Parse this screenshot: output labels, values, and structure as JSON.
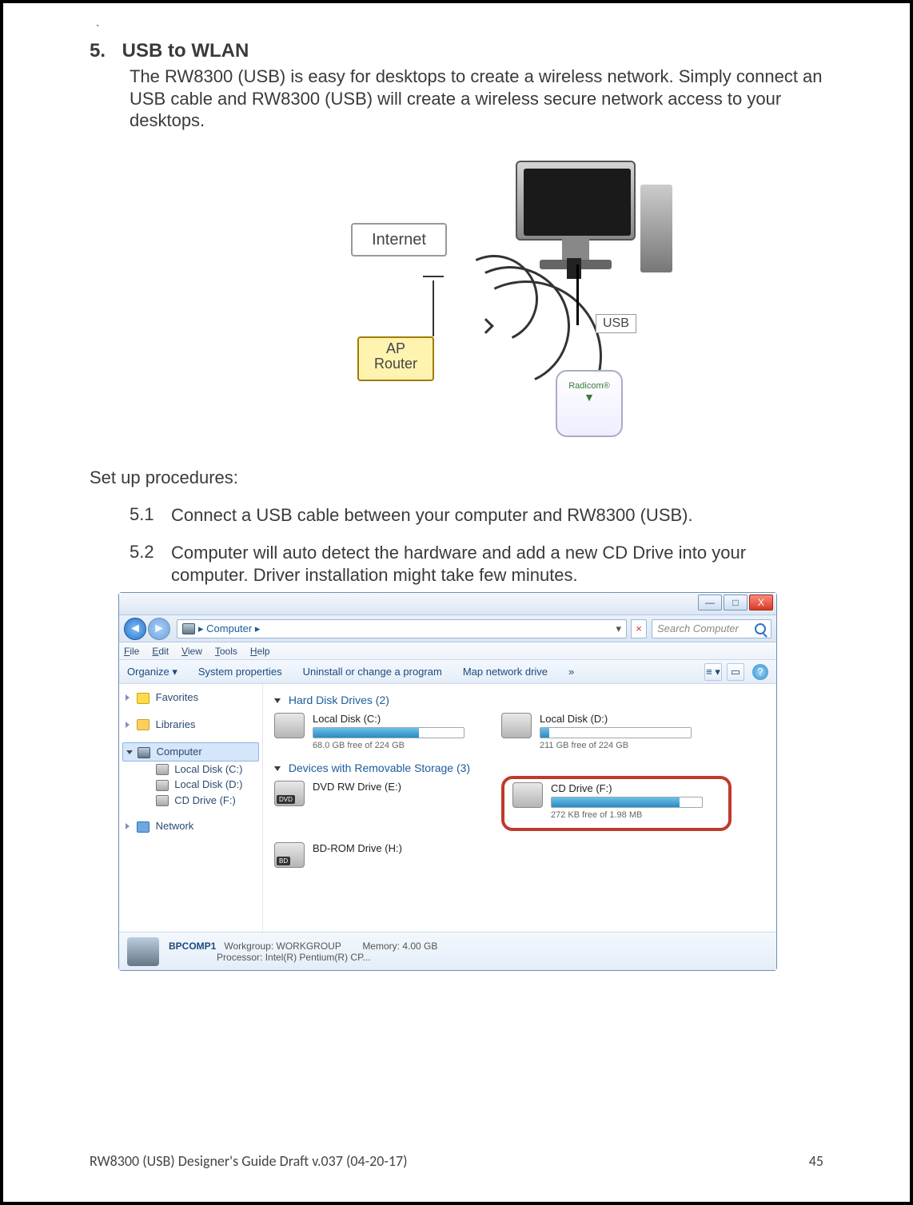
{
  "section": {
    "number": "5.",
    "title": "USB to WLAN",
    "intro": "The RW8300 (USB) is easy for desktops to create a wireless network. Simply connect an USB cable and RW8300 (USB) will create a wireless secure network access to your desktops."
  },
  "diagram": {
    "internet": "Internet",
    "ap_line1": "AP",
    "ap_line2": "Router",
    "usb": "USB",
    "device": "Radicom®"
  },
  "setup_label": "Set up procedures:",
  "steps": [
    {
      "n": "5.1",
      "t": "Connect a USB cable between your computer and RW8300 (USB)."
    },
    {
      "n": "5.2",
      "t": "Computer will auto detect the hardware and add a new CD Drive into your computer. Driver installation might take few minutes."
    }
  ],
  "win": {
    "addr_prefix": "▸ Computer ▸",
    "search_placeholder": "Search Computer",
    "menus": [
      "File",
      "Edit",
      "View",
      "Tools",
      "Help"
    ],
    "toolbar": {
      "organize": "Organize ▾",
      "sysprops": "System properties",
      "uninstall": "Uninstall or change a program",
      "mapdrive": "Map network drive",
      "more": "»"
    },
    "sidebar": {
      "favorites": "Favorites",
      "libraries": "Libraries",
      "computer": "Computer",
      "c": "Local Disk (C:)",
      "d": "Local Disk (D:)",
      "f": "CD Drive (F:)",
      "network": "Network"
    },
    "groups": {
      "hdd": "Hard Disk Drives (2)",
      "removable": "Devices with Removable Storage (3)"
    },
    "drives": {
      "c_name": "Local Disk (C:)",
      "c_sub": "68.0 GB free of 224 GB",
      "c_fill": 70,
      "d_name": "Local Disk (D:)",
      "d_sub": "211 GB free of 224 GB",
      "d_fill": 6,
      "e_name": "DVD RW Drive (E:)",
      "f_name": "CD Drive (F:)",
      "f_sub": "272 KB free of 1.98 MB",
      "f_fill": 85,
      "h_name": "BD-ROM Drive (H:)"
    },
    "status": {
      "name": "BPCOMP1",
      "wg_k": "Workgroup:",
      "wg_v": "WORKGROUP",
      "mem_k": "Memory:",
      "mem_v": "4.00 GB",
      "proc_k": "Processor:",
      "proc_v": "Intel(R) Pentium(R) CP..."
    }
  },
  "footer": {
    "left": "RW8300 (USB) Designer's Guide Draft v.037 (04-20-17)",
    "right": "45"
  }
}
